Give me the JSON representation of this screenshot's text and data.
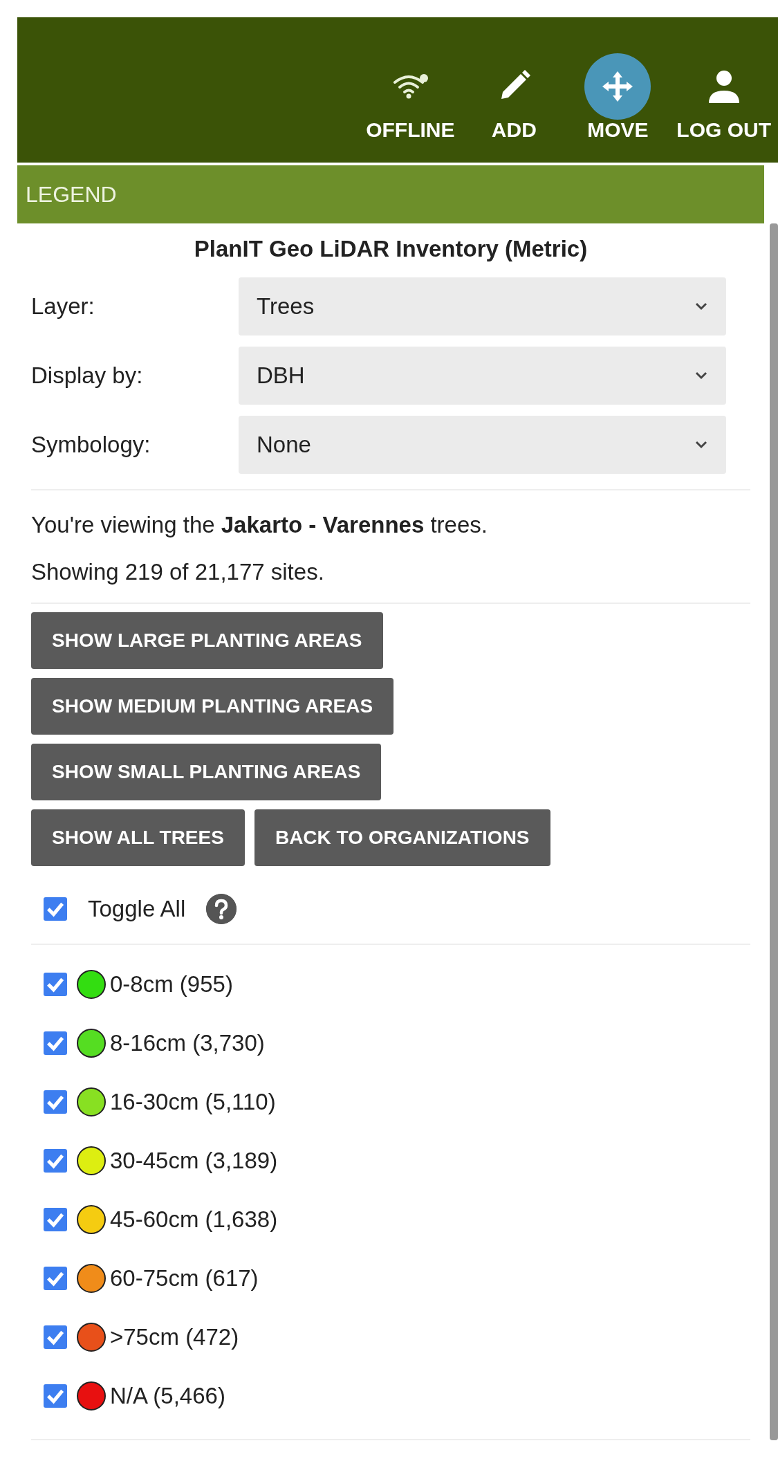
{
  "toolbar": {
    "buttons": [
      {
        "kind": "offline",
        "label": "OFFLINE",
        "selected": false
      },
      {
        "kind": "add",
        "label": "ADD",
        "selected": false
      },
      {
        "kind": "move",
        "label": "MOVE",
        "selected": true
      },
      {
        "kind": "logout",
        "label": "LOG OUT",
        "selected": false
      }
    ]
  },
  "legend": {
    "header": "LEGEND",
    "title": "PlanIT Geo LiDAR Inventory (Metric)",
    "selects": [
      {
        "label": "Layer:",
        "value": "Trees"
      },
      {
        "label": "Display by:",
        "value": "DBH"
      },
      {
        "label": "Symbology:",
        "value": "None"
      }
    ],
    "viewing": "You're viewing the **Jakarto - Varennes** trees.",
    "showing": "Showing 219 of 21,177 sites.",
    "button_rows": [
      [
        "SHOW LARGE PLANTING AREAS"
      ],
      [
        "SHOW MEDIUM PLANTING AREAS"
      ],
      [
        "SHOW SMALL PLANTING AREAS"
      ],
      [
        "SHOW ALL TREES",
        "BACK TO ORGANIZATIONS"
      ]
    ],
    "toggle_all": {
      "label": "Toggle All",
      "checked": true
    },
    "classes": [
      {
        "label": "0-8cm (955)",
        "checked": true,
        "color": "#33dd11"
      },
      {
        "label": "8-16cm (3,730)",
        "checked": true,
        "color": "#55dd22"
      },
      {
        "label": "16-30cm (5,110)",
        "checked": true,
        "color": "#88e022"
      },
      {
        "label": "30-45cm (3,189)",
        "checked": true,
        "color": "#ddee11"
      },
      {
        "label": "45-60cm (1,638)",
        "checked": true,
        "color": "#f5cc11"
      },
      {
        "label": "60-75cm (617)",
        "checked": true,
        "color": "#f08c1a"
      },
      {
        "label": ">75cm (472)",
        "checked": true,
        "color": "#e8501a"
      },
      {
        "label": "N/A (5,466)",
        "checked": true,
        "color": "#e81010"
      }
    ]
  }
}
